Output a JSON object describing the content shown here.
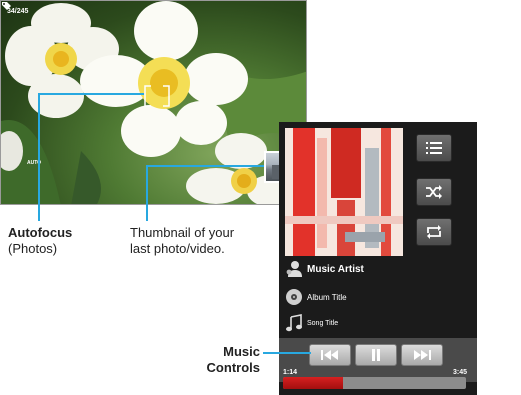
{
  "camera": {
    "counter": "34/245",
    "flash_label": "AUTO",
    "icons": [
      "autofocus-brackets-icon",
      "tag-icon",
      "thumbnail"
    ]
  },
  "music": {
    "artist": "Music Artist",
    "album": "Album Title",
    "song": "Song Title",
    "elapsed": "1:14",
    "duration": "3:45",
    "progress": 0.33,
    "side_buttons": [
      "list-icon",
      "shuffle-icon",
      "repeat-icon"
    ],
    "controls": [
      "previous-icon",
      "pause-icon",
      "next-icon"
    ]
  },
  "callouts": {
    "autofocus_title": "Autofocus",
    "autofocus_sub": "(Photos)",
    "thumbnail_line1": "Thumbnail of your",
    "thumbnail_line2": "last photo/video.",
    "music_line1": "Music",
    "music_line2": "Controls"
  },
  "colors": {
    "callout_line": "#28a8e0",
    "progress": "#c41616",
    "music_bg": "#1b1b1b"
  }
}
